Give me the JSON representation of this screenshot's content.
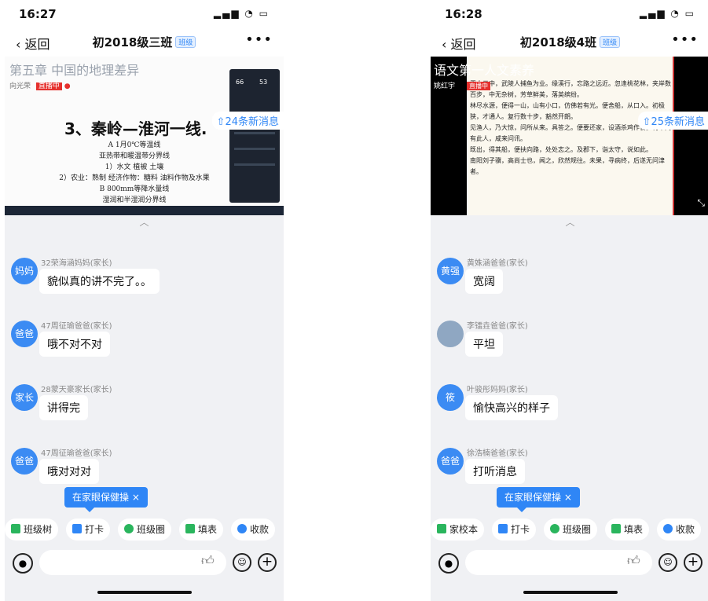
{
  "left": {
    "status_time": "16:27",
    "back": "返回",
    "title": "初2018级三班",
    "badge": "班级",
    "more": "•••",
    "video": {
      "chapter": "第五章   中国的地理差异",
      "teacher": "向光荣",
      "live": "直播中",
      "heading": "3、秦岭—淮河一线.",
      "lines": [
        "A 1月0℃等温线",
        "亚热带和暖温带分界线",
        "1）水文   植被    土壤",
        "2）农业：熟制   经济作物：糖料    油料作物及水果",
        "B 800mm等降水量线",
        "湿润和半湿润分界线"
      ],
      "new_messages": "24条新消息",
      "stat1": "66",
      "stat2": "53"
    },
    "messages": [
      {
        "avatar": "妈妈",
        "sender": "32荣海涵妈妈(家长)",
        "text": "貌似真的讲不完了。。"
      },
      {
        "avatar": "爸爸",
        "sender": "47周征瑜爸爸(家长)",
        "text": "哦不对不对"
      },
      {
        "avatar": "家长",
        "sender": "28蒙天豪家长(家长)",
        "text": "讲得完"
      },
      {
        "avatar": "爸爸",
        "sender": "47周征瑜爸爸(家长)",
        "text": "哦对对对"
      }
    ],
    "exercise": "在家眼保健操 ×",
    "tools": [
      "班级树",
      "打卡",
      "班级圈",
      "填表",
      "收款"
    ]
  },
  "right": {
    "status_time": "16:28",
    "back": "返回",
    "title": "初2018级4班",
    "badge": "班级",
    "more": "•••",
    "video": {
      "overlay": "语文第一人文素养",
      "teacher": "姚红宇",
      "live": "直播中",
      "new_messages": "25条新消息",
      "passage": [
        "晋太元中，武陵人捕鱼为业。缘溪行，忘路之远近。忽逢桃花林，夹岸数百步，中无杂树，芳草鲜美，落英缤纷。",
        "林尽水源，便得一山，山有小口，仿佛若有光。便舍船，从口入。初极狭，才通人。复行数十步，豁然开朗。",
        "见渔人，乃大惊，问所从来。具答之。便要还家，设酒杀鸡作食。村中闻有此人，咸来问讯。",
        "既出，得其船，便扶向路，处处志之。及郡下，诣太守，说如此。",
        "南阳刘子骥，高尚士也，闻之，欣然规往。未果，寻病终，后遂无问津者。"
      ]
    },
    "messages": [
      {
        "avatar": "黄强",
        "sender": "黄姝涵爸爸(家长)",
        "text": "宽阔"
      },
      {
        "avatar": "",
        "sender": "李镭垚爸爸(家长)",
        "text": "平坦"
      },
      {
        "avatar": "筱",
        "sender": "叶骏彤妈妈(家长)",
        "text": "愉快高兴的样子"
      },
      {
        "avatar": "爸爸",
        "sender": "徐浩楠爸爸(家长)",
        "text": "打听消息"
      }
    ],
    "exercise": "在家眼保健操 ×",
    "tools": [
      "家校本",
      "打卡",
      "班级圈",
      "填表",
      "收款"
    ]
  },
  "colors": {
    "accent": "#2f86f6",
    "live_red": "#e5312e"
  }
}
